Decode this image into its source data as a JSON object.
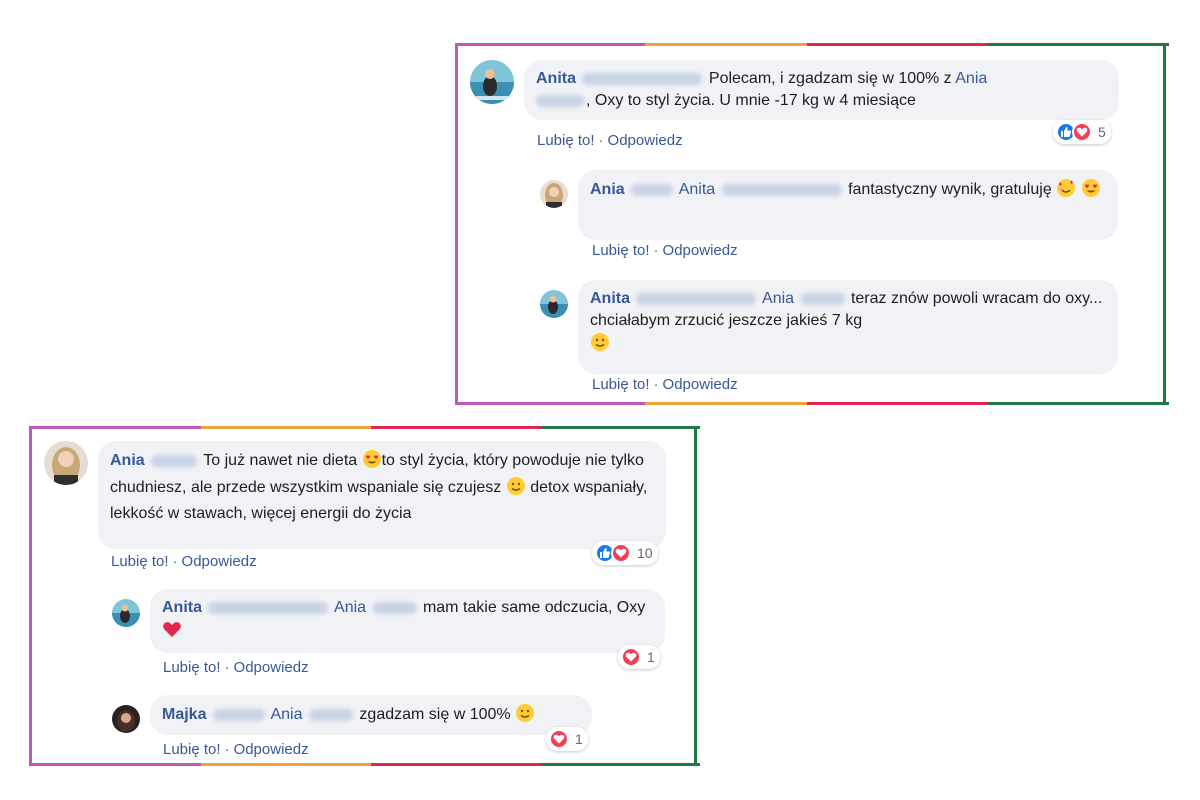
{
  "colors": {
    "border_purple": "#bd59b4",
    "border_orange": "#f0a23f",
    "border_red": "#e2264d",
    "border_green": "#1e7a44",
    "name_blue": "#385898",
    "bubble_bg": "#f0f2f5",
    "like_blue": "#1877f2",
    "love_red": "#f33e58"
  },
  "panel_a": {
    "main_comment": {
      "author_first": "Anita",
      "text_before_mention": "Polecam, i zgadzam się w 100% z",
      "mention_first": "Ania",
      "text_after_mention": ", Oxy to styl życia. U mnie -17 kg w 4 miesiące",
      "like_label": "Lubię to!",
      "reply_label": "Odpowiedz",
      "reaction_count": "5",
      "reaction_icons": [
        "like-icon",
        "love-icon"
      ]
    },
    "reply_1": {
      "author_first": "Ania",
      "mention_first": "Anita",
      "text": "fantastyczny wynik, gratuluję",
      "emojis": [
        "smiling-face-with-hearts-emoji",
        "heart-eyes-emoji"
      ],
      "like_label": "Lubię to!",
      "reply_label": "Odpowiedz"
    },
    "reply_2": {
      "author_first": "Anita",
      "mention_first": "Ania",
      "text": "teraz znów powoli wracam do oxy... chciałabym zrzucić jeszcze jakieś 7 kg",
      "emojis": [
        "slightly-smiling-face-emoji"
      ],
      "like_label": "Lubię to!",
      "reply_label": "Odpowiedz"
    }
  },
  "panel_b": {
    "main_comment": {
      "author_first": "Ania",
      "text_part_1": "To już nawet nie dieta",
      "text_part_2": "to styl życia, który powoduje nie tylko chudniesz, ale przede wszystkim wspaniale się czujesz",
      "text_part_3": "detox wspaniały, lekkość w stawach, więcej energii do życia",
      "emojis": [
        "heart-eyes-emoji",
        "slightly-smiling-face-emoji"
      ],
      "like_label": "Lubię to!",
      "reply_label": "Odpowiedz",
      "reaction_count": "10",
      "reaction_icons": [
        "like-icon",
        "love-icon"
      ]
    },
    "reply_1": {
      "author_first": "Anita",
      "mention_first": "Ania",
      "text": "mam takie same odczucia, Oxy",
      "emojis": [
        "red-heart-emoji"
      ],
      "like_label": "Lubię to!",
      "reply_label": "Odpowiedz",
      "reaction_count": "1",
      "reaction_icons": [
        "love-icon"
      ]
    },
    "reply_2": {
      "author_first": "Majka",
      "mention_first": "Ania",
      "text": "zgadzam się w 100%",
      "emojis": [
        "slightly-smiling-face-emoji"
      ],
      "like_label": "Lubię to!",
      "reply_label": "Odpowiedz",
      "reaction_count": "1",
      "reaction_icons": [
        "love-icon"
      ]
    }
  }
}
